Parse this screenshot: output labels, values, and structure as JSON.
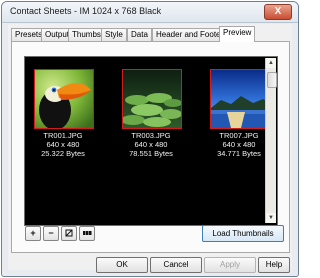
{
  "window": {
    "title": "Contact Sheets - IM 1024 x 768 Black",
    "close_symbol": "X"
  },
  "tabs": [
    {
      "label": "Presets"
    },
    {
      "label": "Output"
    },
    {
      "label": "Thumbs"
    },
    {
      "label": "Style"
    },
    {
      "label": "Data"
    },
    {
      "label": "Header and Footer"
    },
    {
      "label": "Preview",
      "active": true
    }
  ],
  "thumbnails": [
    {
      "file": "TR001.JPG",
      "dimensions": "640 x 480",
      "size": "25.322 Bytes",
      "scene": "toucan-photo"
    },
    {
      "file": "TR003.JPG",
      "dimensions": "640 x 480",
      "size": "78.551 Bytes",
      "scene": "lily-pads-photo"
    },
    {
      "file": "TR007.JPG",
      "dimensions": "640 x 480",
      "size": "34.771 Bytes",
      "scene": "lake-landscape-photo"
    }
  ],
  "toolbar": {
    "zoom_in": "+",
    "zoom_out": "−"
  },
  "load_thumbnails_label": "Load Thumbnails",
  "buttons": {
    "ok": "OK",
    "cancel": "Cancel",
    "apply": "Apply",
    "help": "Help"
  },
  "colors": {
    "preview_bg": "#000000",
    "thumb_border": "#d31b1b",
    "accent": "#3c7fb1"
  }
}
